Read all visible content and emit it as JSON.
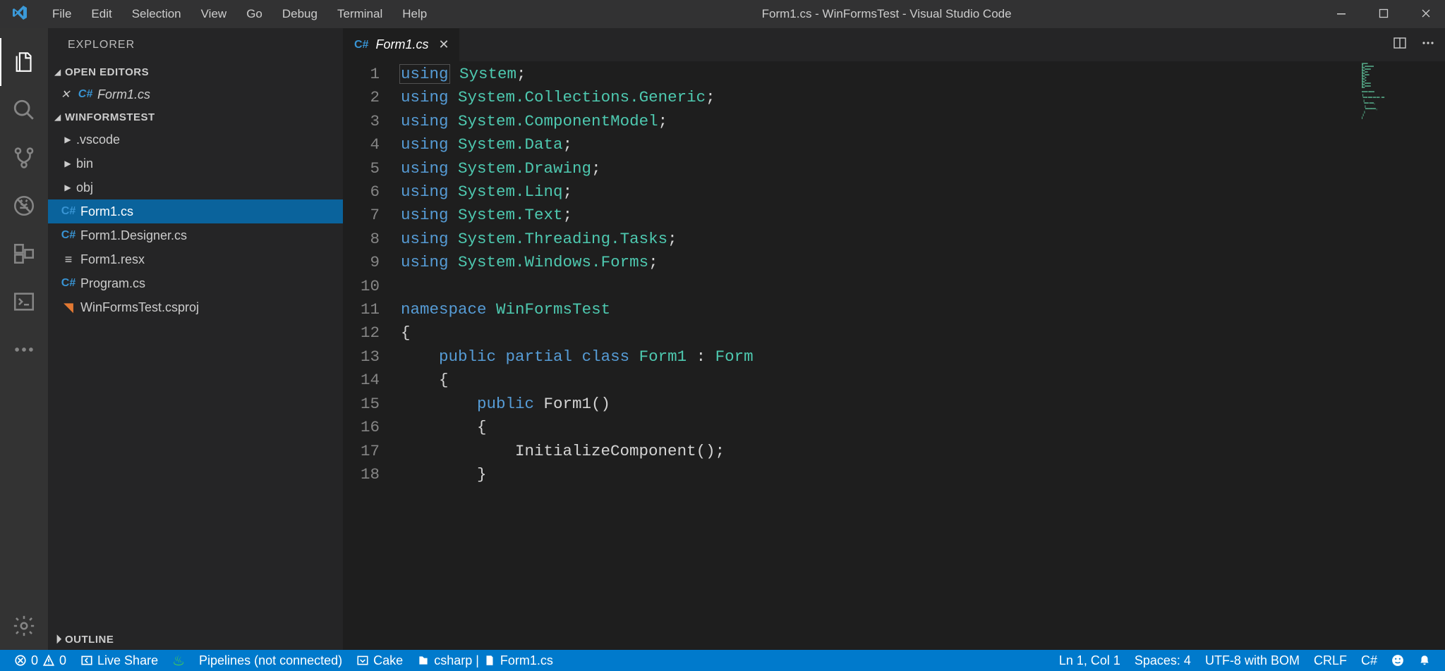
{
  "menu": [
    "File",
    "Edit",
    "Selection",
    "View",
    "Go",
    "Debug",
    "Terminal",
    "Help"
  ],
  "title": "Form1.cs - WinFormsTest - Visual Studio Code",
  "sidebar": {
    "header": "EXPLORER",
    "open_editors": "OPEN EDITORS",
    "open_file": "Form1.cs",
    "project": "WINFORMSTEST",
    "items": [
      {
        "kind": "folder",
        "label": ".vscode"
      },
      {
        "kind": "folder",
        "label": "bin"
      },
      {
        "kind": "folder",
        "label": "obj"
      },
      {
        "kind": "cs",
        "label": "Form1.cs",
        "selected": true
      },
      {
        "kind": "cs",
        "label": "Form1.Designer.cs"
      },
      {
        "kind": "resx",
        "label": "Form1.resx"
      },
      {
        "kind": "cs",
        "label": "Program.cs"
      },
      {
        "kind": "csproj",
        "label": "WinFormsTest.csproj"
      }
    ],
    "outline": "OUTLINE"
  },
  "tab": {
    "label": "Form1.cs"
  },
  "code": {
    "lines": [
      [
        {
          "t": "using",
          "c": "kw"
        },
        {
          "t": " ",
          "c": "pl"
        },
        {
          "t": "System",
          "c": "type"
        },
        {
          "t": ";",
          "c": "pl"
        }
      ],
      [
        {
          "t": "using",
          "c": "kw"
        },
        {
          "t": " ",
          "c": "pl"
        },
        {
          "t": "System.Collections.Generic",
          "c": "type"
        },
        {
          "t": ";",
          "c": "pl"
        }
      ],
      [
        {
          "t": "using",
          "c": "kw"
        },
        {
          "t": " ",
          "c": "pl"
        },
        {
          "t": "System.ComponentModel",
          "c": "type"
        },
        {
          "t": ";",
          "c": "pl"
        }
      ],
      [
        {
          "t": "using",
          "c": "kw"
        },
        {
          "t": " ",
          "c": "pl"
        },
        {
          "t": "System.Data",
          "c": "type"
        },
        {
          "t": ";",
          "c": "pl"
        }
      ],
      [
        {
          "t": "using",
          "c": "kw"
        },
        {
          "t": " ",
          "c": "pl"
        },
        {
          "t": "System.Drawing",
          "c": "type"
        },
        {
          "t": ";",
          "c": "pl"
        }
      ],
      [
        {
          "t": "using",
          "c": "kw"
        },
        {
          "t": " ",
          "c": "pl"
        },
        {
          "t": "System.Linq",
          "c": "type"
        },
        {
          "t": ";",
          "c": "pl"
        }
      ],
      [
        {
          "t": "using",
          "c": "kw"
        },
        {
          "t": " ",
          "c": "pl"
        },
        {
          "t": "System.Text",
          "c": "type"
        },
        {
          "t": ";",
          "c": "pl"
        }
      ],
      [
        {
          "t": "using",
          "c": "kw"
        },
        {
          "t": " ",
          "c": "pl"
        },
        {
          "t": "System.Threading.Tasks",
          "c": "type"
        },
        {
          "t": ";",
          "c": "pl"
        }
      ],
      [
        {
          "t": "using",
          "c": "kw"
        },
        {
          "t": " ",
          "c": "pl"
        },
        {
          "t": "System.Windows.Forms",
          "c": "type"
        },
        {
          "t": ";",
          "c": "pl"
        }
      ],
      [],
      [
        {
          "t": "namespace",
          "c": "kw"
        },
        {
          "t": " ",
          "c": "pl"
        },
        {
          "t": "WinFormsTest",
          "c": "type"
        }
      ],
      [
        {
          "t": "{",
          "c": "pl"
        }
      ],
      [
        {
          "t": "    ",
          "c": "pl"
        },
        {
          "t": "public",
          "c": "kw"
        },
        {
          "t": " ",
          "c": "pl"
        },
        {
          "t": "partial",
          "c": "kw"
        },
        {
          "t": " ",
          "c": "pl"
        },
        {
          "t": "class",
          "c": "kw"
        },
        {
          "t": " ",
          "c": "pl"
        },
        {
          "t": "Form1",
          "c": "type"
        },
        {
          "t": " : ",
          "c": "pl"
        },
        {
          "t": "Form",
          "c": "type"
        }
      ],
      [
        {
          "t": "    {",
          "c": "pl"
        }
      ],
      [
        {
          "t": "        ",
          "c": "pl"
        },
        {
          "t": "public",
          "c": "kw"
        },
        {
          "t": " Form1()",
          "c": "pl"
        }
      ],
      [
        {
          "t": "        {",
          "c": "pl"
        }
      ],
      [
        {
          "t": "            InitializeComponent();",
          "c": "pl"
        }
      ],
      [
        {
          "t": "        }",
          "c": "pl"
        }
      ]
    ]
  },
  "status": {
    "errors": "0",
    "warnings": "0",
    "liveshare": "Live Share",
    "pipelines": "Pipelines (not connected)",
    "cake": "Cake",
    "solution": "csharp | ",
    "solution_file": "Form1.cs",
    "lncol": "Ln 1, Col 1",
    "spaces": "Spaces: 4",
    "encoding": "UTF-8 with BOM",
    "eol": "CRLF",
    "lang": "C#"
  }
}
